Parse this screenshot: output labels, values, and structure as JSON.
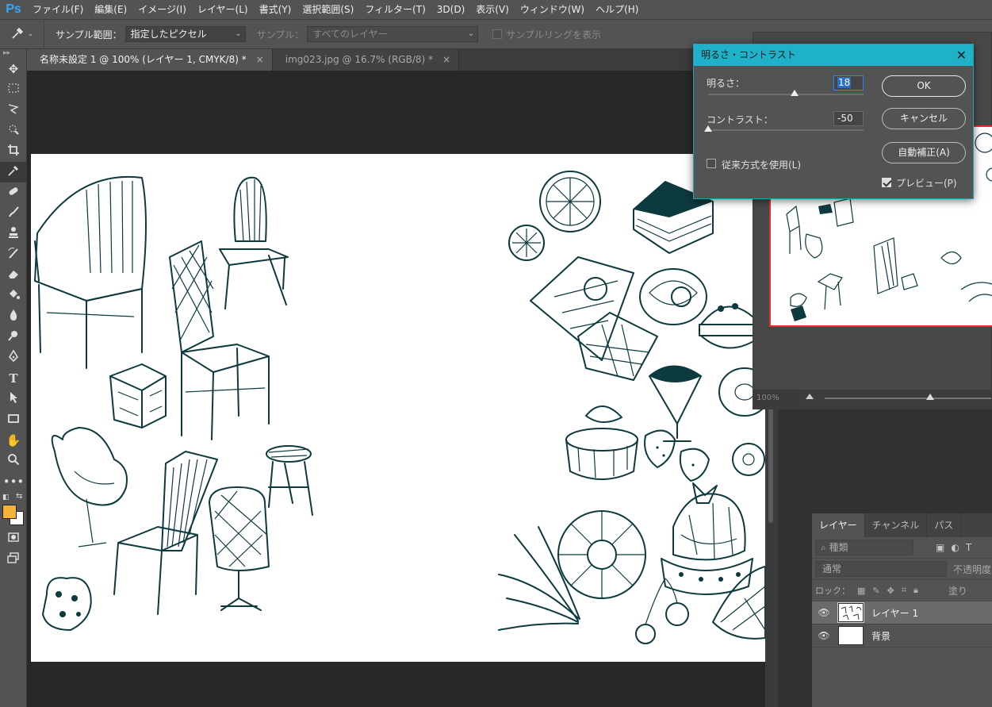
{
  "app": {
    "logo": "Ps"
  },
  "menu": [
    "ファイル(F)",
    "編集(E)",
    "イメージ(I)",
    "レイヤー(L)",
    "書式(Y)",
    "選択範囲(S)",
    "フィルター(T)",
    "3D(D)",
    "表示(V)",
    "ウィンドウ(W)",
    "ヘルプ(H)"
  ],
  "options": {
    "sample_size_label": "サンプル範囲：",
    "sample_size_value": "指定したピクセル",
    "sample_label": "サンプル：",
    "sample_value": "すべてのレイヤー",
    "show_ring_label": "サンプルリングを表示"
  },
  "tabs": [
    {
      "title": "名称未設定 1 @ 100% (レイヤー 1, CMYK/8) *",
      "close": "×"
    },
    {
      "title": "img023.jpg @ 16.7% (RGB/8) *",
      "close": "×"
    }
  ],
  "navigator": {
    "zoom": "100%"
  },
  "dialog": {
    "title": "明るさ・コントラスト",
    "close": "✕",
    "brightness_label": "明るさ：",
    "brightness_value": "18",
    "contrast_label": "コントラスト：",
    "contrast_value": "-50",
    "legacy_label": "従来方式を使用(L)",
    "ok": "OK",
    "cancel": "キャンセル",
    "auto": "自動補正(A)",
    "preview": "プレビュー(P)"
  },
  "layers_panel": {
    "tabs": [
      "レイヤー",
      "チャンネル",
      "パス"
    ],
    "filter_placeholder": "種類",
    "blend_mode": "通常",
    "opacity_label": "不透明度",
    "lock_label": "ロック：",
    "fill_label": "塗り",
    "layers": [
      {
        "name": "レイヤー 1",
        "selected": true
      },
      {
        "name": "背景",
        "selected": false
      }
    ]
  },
  "colors": {
    "foreground": "#f5b436",
    "background": "#ffffff",
    "dialog_title": "#1fb1c8",
    "ink": "#0d3a3f"
  }
}
